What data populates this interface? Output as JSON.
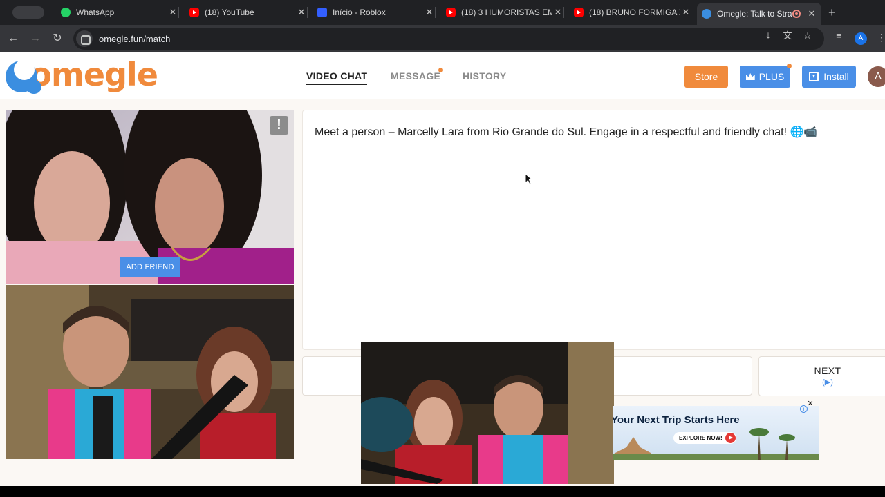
{
  "browser": {
    "tabs": [
      {
        "title": "WhatsApp",
        "icon": "whatsapp-icon"
      },
      {
        "title": "(18) YouTube",
        "icon": "youtube-icon"
      },
      {
        "title": "Início - Roblox",
        "icon": "roblox-icon"
      },
      {
        "title": "(18) 3 HUMORISTAS EM",
        "icon": "youtube-icon"
      },
      {
        "title": "(18) BRUNO FORMIGA X",
        "icon": "youtube-icon"
      },
      {
        "title": "Omegle: Talk to Stra",
        "icon": "omegle-icon",
        "active": true
      }
    ],
    "url": "omegle.fun/match",
    "profile_initial": "A"
  },
  "header": {
    "logo_text": "omegle",
    "nav": [
      {
        "label": "VIDEO CHAT",
        "active": true
      },
      {
        "label": "MESSAGE",
        "has_dot": true
      },
      {
        "label": "HISTORY"
      }
    ],
    "store_label": "Store",
    "plus_label": "PLUS",
    "install_label": "Install",
    "avatar_initial": "A"
  },
  "video": {
    "report_label": "!",
    "add_friend_label": "ADD FRIEND"
  },
  "chat": {
    "message": "Meet a person – Marcelly Lara from Rio Grande do Sul. Engage in a respectful and friendly chat! 🌐📹",
    "input_value": "",
    "next_label": "NEXT",
    "next_key": "(▶)"
  },
  "ad": {
    "title": "Your Next Trip Starts Here",
    "cta": "EXPLORE NOW!",
    "close": "✕",
    "info": "i"
  },
  "colors": {
    "accent_orange": "#f08a3c",
    "accent_blue": "#4a8fe7",
    "page_bg": "#fbf8f4"
  }
}
